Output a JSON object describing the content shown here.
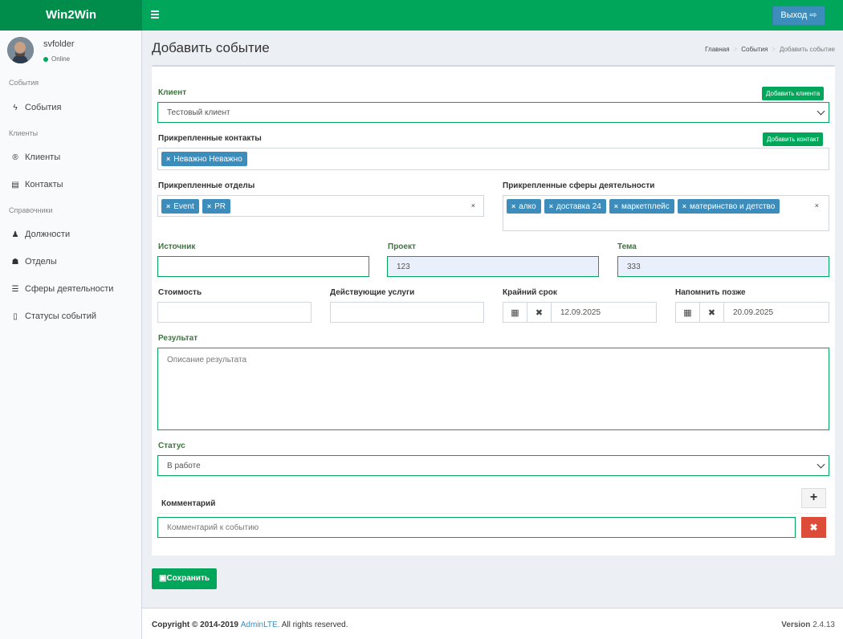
{
  "app": {
    "title": "Win2Win",
    "logout_label": "Выход"
  },
  "user": {
    "name": "svfolder",
    "status": "Online"
  },
  "sidebar": {
    "sections": [
      {
        "header": "События",
        "items": [
          {
            "label": "События",
            "icon": "bolt-icon"
          }
        ]
      },
      {
        "header": "Клиенты",
        "items": [
          {
            "label": "Клиенты",
            "icon": "registered-icon"
          },
          {
            "label": "Контакты",
            "icon": "address-book-icon"
          }
        ]
      },
      {
        "header": "Справочники",
        "items": [
          {
            "label": "Должности",
            "icon": "user-tie-icon"
          },
          {
            "label": "Отделы",
            "icon": "users-icon"
          },
          {
            "label": "Сферы деятельности",
            "icon": "list-icon"
          },
          {
            "label": "Статусы событий",
            "icon": "clipboard-icon"
          }
        ]
      }
    ]
  },
  "page": {
    "title": "Добавить событие",
    "breadcrumb": [
      "Главная",
      "События",
      "Добавить событие"
    ]
  },
  "form": {
    "client": {
      "label": "Клиент",
      "value": "Тестовый клиент",
      "add_label": "Добавить клиента"
    },
    "contacts": {
      "label": "Прикрепленные контакты",
      "add_label": "Добавить контакт",
      "tags": [
        "Неважно Неважно"
      ]
    },
    "departments": {
      "label": "Прикрепленные отделы",
      "tags": [
        "Event",
        "PR"
      ]
    },
    "spheres": {
      "label": "Прикрепленные сферы деятельности",
      "tags": [
        "алко",
        "доставка 24",
        "маркетплейс",
        "материнство и детство"
      ]
    },
    "source": {
      "label": "Источник",
      "value": ""
    },
    "project": {
      "label": "Проект",
      "value": "123"
    },
    "topic": {
      "label": "Тема",
      "value": "333"
    },
    "cost": {
      "label": "Стоимость",
      "value": ""
    },
    "services": {
      "label": "Действующие услуги",
      "value": ""
    },
    "deadline": {
      "label": "Крайний срок",
      "value": "12.09.2025"
    },
    "remind": {
      "label": "Напомнить позже",
      "value": "20.09.2025"
    },
    "result": {
      "label": "Результат",
      "placeholder": "Описание результата"
    },
    "status": {
      "label": "Статус",
      "value": "В работе"
    },
    "comment": {
      "label": "Комментарий",
      "placeholder": "Комментарий к событию"
    },
    "save_label": "Сохранить"
  },
  "footer": {
    "copyright": "Copyright © 2014-2019 ",
    "brand": "AdminLTE.",
    "rights": " All rights reserved.",
    "version_label": "Version",
    "version": "2.4.13"
  },
  "colors": {
    "primary": "#00a65a",
    "blue": "#3c8dbc",
    "danger": "#dd4b39"
  }
}
